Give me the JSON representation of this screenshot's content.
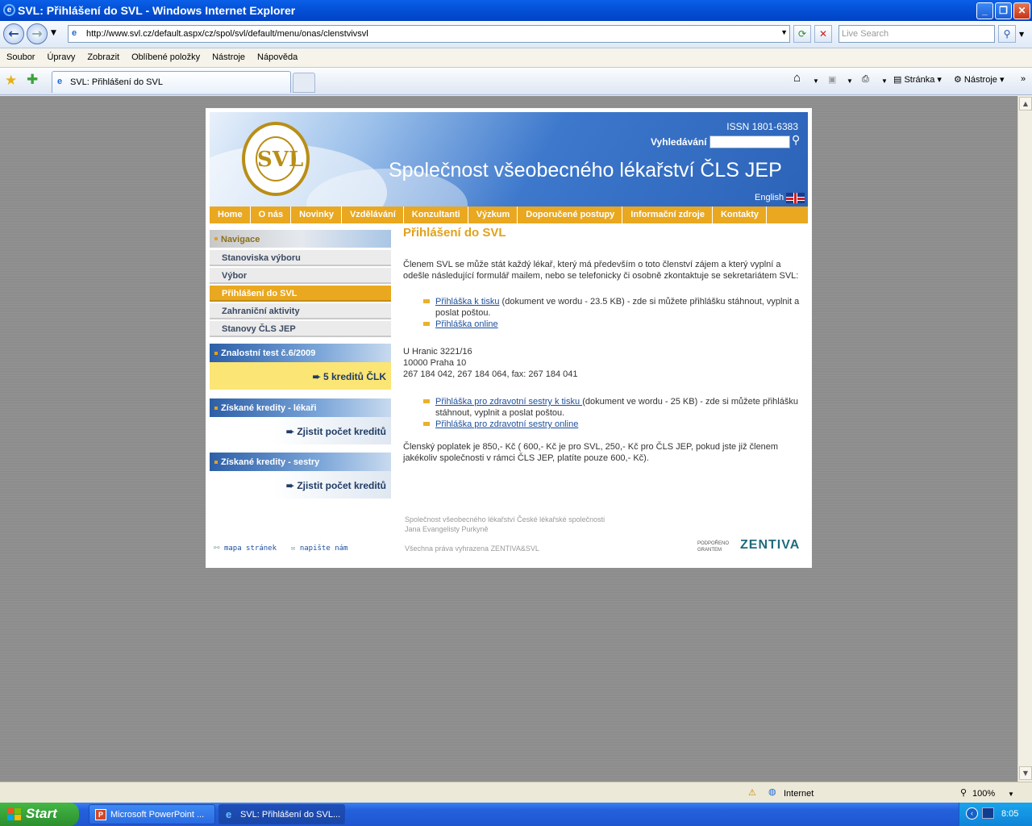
{
  "window": {
    "title": "SVL: Přihlášení do SVL - Windows Internet Explorer"
  },
  "browser": {
    "url": "http://www.svl.cz/default.aspx/cz/spol/svl/default/menu/onas/clenstvivsvl",
    "search_placeholder": "Live Search",
    "menu": [
      "Soubor",
      "Úpravy",
      "Zobrazit",
      "Oblíbené položky",
      "Nástroje",
      "Nápověda"
    ],
    "tab_title": "SVL: Přihlášení do SVL",
    "page_label": "Stránka",
    "tools_label": "Nástroje"
  },
  "site": {
    "issn": "ISSN 1801-6383",
    "search_label": "Vyhledávání",
    "title": "Společnost všeobecného lékařství ČLS JEP",
    "english": "English",
    "nav": [
      "Home",
      "O nás",
      "Novinky",
      "Vzdělávání",
      "Konzultanti",
      "Výzkum",
      "Doporučené postupy",
      "Informační zdroje",
      "Kontakty"
    ],
    "sidebar": {
      "header": "Navigace",
      "items": [
        "Stanoviska výboru",
        "Výbor",
        "Přihlášení do SVL",
        "Zahraniční aktivity",
        "Stanovy ČLS JEP"
      ],
      "boxes": [
        {
          "title": "Znalostní test č.6/2009",
          "link": "5 kreditů ČLK"
        },
        {
          "title": "Získané kredity - lékaři",
          "link": "Zjistit počet kreditů"
        },
        {
          "title": "Získané kredity - sestry",
          "link": "Zjistit počet kreditů"
        }
      ],
      "sitemap": "mapa stránek",
      "write": "napište nám"
    },
    "main": {
      "heading": "Přihlášení do SVL",
      "intro": "Členem SVL se může stát každý lékař, který má především o toto členství zájem a který vyplní a odešle následující formulář mailem, nebo se telefonicky či osobně zkontaktuje se sekretariátem SVL:",
      "list1": [
        {
          "link": "Přihláška k tisku",
          "text": " (dokument ve wordu - 23.5 KB) - zde si můžete přihlášku stáhnout, vyplnit a poslat poštou."
        },
        {
          "link": "Přihláška online",
          "text": ""
        }
      ],
      "address": [
        "U Hranic 3221/16",
        "10000 Praha 10",
        "267 184 042, 267 184 064, fax: 267 184 041"
      ],
      "list2": [
        {
          "link": "Přihláška pro zdravotní sestry k tisku ",
          "text": "(dokument ve wordu - 25 KB) - zde si můžete přihlášku stáhnout, vyplnit a poslat poštou."
        },
        {
          "link": "Přihláška pro zdravotní sestry online",
          "text": ""
        }
      ],
      "fee": "Členský poplatek je 850,- Kč ( 600,- Kč je pro SVL, 250,- Kč pro ČLS JEP, pokud jste již členem jakékoliv společnosti v rámci ČLS JEP, platíte pouze 600,- Kč)."
    },
    "footer": {
      "line1": "Společnost všeobecného lékařství České lékařské společnosti",
      "line2": "Jana Evangelisty Purkyně",
      "rights": "Všechna práva vyhrazena ZENTIVA&SVL",
      "sponsor_small": "PODPOŘENO GRANTEM",
      "sponsor": "ZENTIVA"
    }
  },
  "status": {
    "zone": "Internet",
    "zoom": "100%"
  },
  "taskbar": {
    "start": "Start",
    "items": [
      "Microsoft PowerPoint ...",
      "SVL: Přihlášení do SVL..."
    ],
    "clock": "8:05"
  }
}
